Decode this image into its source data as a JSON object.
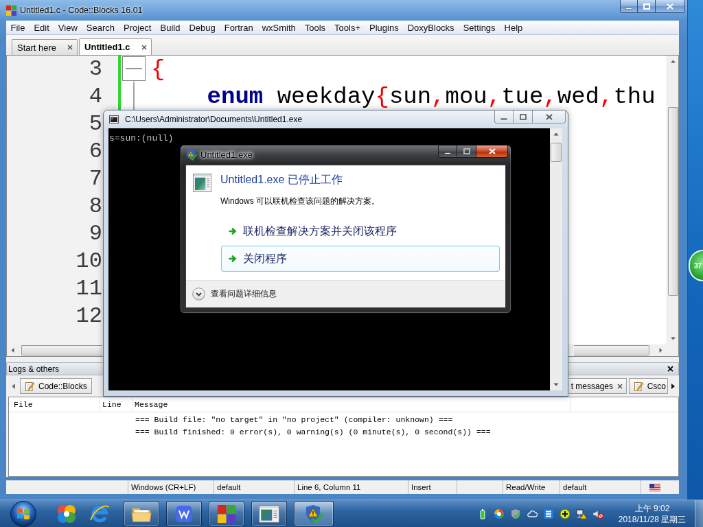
{
  "window": {
    "title": "Untitled1.c - Code::Blocks 16.01"
  },
  "menu": [
    "File",
    "Edit",
    "View",
    "Search",
    "Project",
    "Build",
    "Debug",
    "Fortran",
    "wxSmith",
    "Tools",
    "Tools+",
    "Plugins",
    "DoxyBlocks",
    "Settings",
    "Help"
  ],
  "tabs": [
    {
      "label": "Start here",
      "selected": false
    },
    {
      "label": "Untitled1.c",
      "selected": true
    }
  ],
  "editor": {
    "lines": [
      {
        "number": "3",
        "changed": true,
        "fold_header": true,
        "fold_guide": false,
        "indented": false,
        "tokens": [
          {
            "text": "{",
            "kind": "operator"
          }
        ]
      },
      {
        "number": "4",
        "changed": true,
        "fold_header": false,
        "fold_guide": true,
        "indented": true,
        "tokens": [
          {
            "text": "enum",
            "kind": "keyword"
          },
          {
            "text": " weekday",
            "kind": "plain"
          },
          {
            "text": "{",
            "kind": "operator"
          },
          {
            "text": "sun",
            "kind": "plain"
          },
          {
            "text": ",",
            "kind": "operator"
          },
          {
            "text": "mou",
            "kind": "plain"
          },
          {
            "text": ",",
            "kind": "operator"
          },
          {
            "text": "tue",
            "kind": "plain"
          },
          {
            "text": ",",
            "kind": "operator"
          },
          {
            "text": "wed",
            "kind": "plain"
          },
          {
            "text": ",",
            "kind": "operator"
          },
          {
            "text": "thu",
            "kind": "plain"
          }
        ]
      },
      {
        "number": "5"
      },
      {
        "number": "6"
      },
      {
        "number": "7"
      },
      {
        "number": "8"
      },
      {
        "number": "9"
      },
      {
        "number": "10"
      },
      {
        "number": "11"
      },
      {
        "number": "12"
      }
    ]
  },
  "logs": {
    "title": "Logs & others",
    "tabs": [
      {
        "label": "Code::Blocks",
        "has_icon": true,
        "closable": false
      },
      {
        "label": "t messages",
        "has_icon": false,
        "closable": true
      },
      {
        "label": "Csco",
        "has_icon": true,
        "closable": false
      }
    ],
    "columns": [
      "File",
      "Line",
      "Message"
    ],
    "rows": [
      {
        "message": "=== Build file: \"no target\" in \"no project\" (compiler: unknown) ==="
      },
      {
        "message": "=== Build finished: 0 error(s), 0 warning(s) (0 minute(s), 0 second(s)) ==="
      }
    ]
  },
  "status_bar": [
    "Windows (CR+LF)",
    "default",
    "Line 6, Column 11",
    "Insert",
    "Read/Write",
    "default"
  ],
  "console": {
    "title": "C:\\Users\\Administrator\\Documents\\Untitled1.exe",
    "output": "s=sun:(null)"
  },
  "dialog": {
    "title": "Untitled1.exe",
    "heading": "Untitled1.exe 已停止工作",
    "message": "Windows 可以联机检查该问题的解决方案。",
    "options": [
      {
        "label": "联机检查解决方案并关闭该程序",
        "selected": false
      },
      {
        "label": "关闭程序",
        "selected": true
      }
    ],
    "details": "查看问题详细信息"
  },
  "desktop_widget": {
    "text": "37"
  },
  "clock": {
    "time": "上午 9:02",
    "date": "2018/11/28 星期三"
  }
}
